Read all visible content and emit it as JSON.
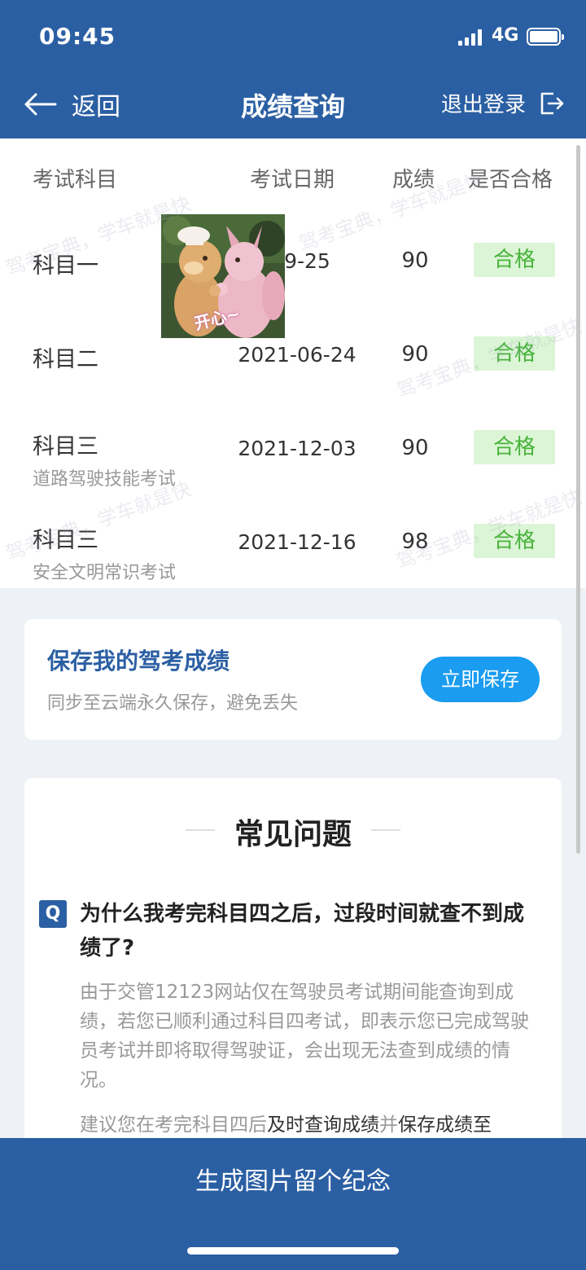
{
  "status": {
    "time": "09:45",
    "network": "4G"
  },
  "nav": {
    "back_label": "返回",
    "title": "成绩查询",
    "logout_label": "退出登录"
  },
  "table": {
    "headers": [
      "考试科目",
      "考试日期",
      "成绩",
      "是否合格"
    ],
    "rows": [
      {
        "subject": "科目一",
        "sub": "",
        "date": "-09-25",
        "score": "90",
        "status": "合格"
      },
      {
        "subject": "科目二",
        "sub": "",
        "date": "2021-06-24",
        "score": "90",
        "status": "合格"
      },
      {
        "subject": "科目三",
        "sub": "道路驾驶技能考试",
        "date": "2021-12-03",
        "score": "90",
        "status": "合格"
      },
      {
        "subject": "科目三",
        "sub": "安全文明常识考试",
        "date": "2021-12-16",
        "score": "98",
        "status": "合格"
      }
    ]
  },
  "sticker": {
    "text": "开心~"
  },
  "watermark": "驾考宝典，学车就是快",
  "save_card": {
    "title": "保存我的驾考成绩",
    "subtitle": "同步至云端永久保存，避免丢失",
    "button": "立即保存"
  },
  "faq": {
    "title": "常见问题",
    "q_badge": "Q",
    "question": "为什么我考完科目四之后，过段时间就查不到成绩了?",
    "answer": "由于交管12123网站仅在驾驶员考试期间能查询到成绩，若您已顺利通过科目四考试，即表示您已完成驾驶员考试并即将取得驾驶证，会出现无法查到成绩的情况。",
    "advice_prefix": "建议您在考完科目四后",
    "advice_em1": "及时查询成绩",
    "advice_mid": "并",
    "advice_em2": "保存成绩至"
  },
  "bottom": {
    "label": "生成图片留个纪念"
  },
  "colors": {
    "primary": "#2b5fa3",
    "pass_bg": "#dcf5d6",
    "pass_text": "#49b33c",
    "save_button": "#1a9cf0"
  }
}
